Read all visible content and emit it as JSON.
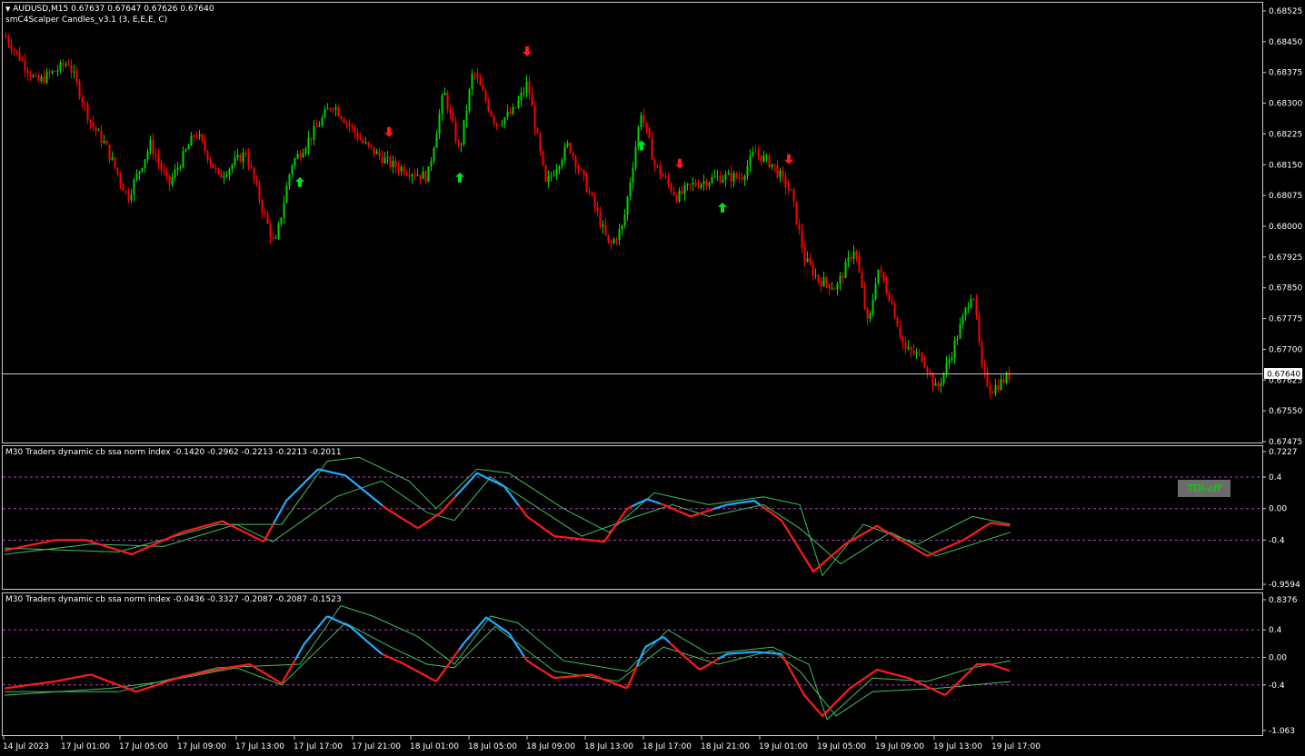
{
  "header": {
    "symbol_line": "AUDUSD,M15  0.67637 0.67647 0.67626 0.67640",
    "indicator_line": "smC4Scalper Candles_v3.1 (3, E,E,E, C)"
  },
  "colors": {
    "background": "#000000",
    "bull": "#00d400",
    "bear": "#ff0000",
    "grid": "#c8c8c8",
    "fast_up": "#22aaff",
    "fast_down": "#ff1a1a",
    "signal": "#40c060",
    "level": "#b040c0"
  },
  "price_axis": {
    "ticks": [
      "0.68525",
      "0.68450",
      "0.68375",
      "0.68300",
      "0.68225",
      "0.68150",
      "0.68075",
      "0.68000",
      "0.67925",
      "0.67850",
      "0.67775",
      "0.67700",
      "0.67625",
      "0.67550",
      "0.67475"
    ],
    "current_label": "0.67640",
    "current_value": 0.6764
  },
  "time_axis": {
    "labels": [
      "14 Jul 2023",
      "17 Jul 01:00",
      "17 Jul 05:00",
      "17 Jul 09:00",
      "17 Jul 13:00",
      "17 Jul 17:00",
      "17 Jul 21:00",
      "18 Jul 01:00",
      "18 Jul 05:00",
      "18 Jul 09:00",
      "18 Jul 13:00",
      "18 Jul 17:00",
      "18 Jul 21:00",
      "19 Jul 01:00",
      "19 Jul 05:00",
      "19 Jul 09:00",
      "19 Jul 13:00",
      "19 Jul 17:00"
    ]
  },
  "sub1": {
    "title": "M30  Traders dynamic cb ssa norm index -0.1420 -0.2962 -0.2213 -0.2213 -0.2011",
    "axis": [
      "0.7227",
      "0.4",
      "0.00",
      "-0.4",
      "-0.9594"
    ],
    "button": "TDI-off"
  },
  "sub2": {
    "title": "M30  Traders dynamic cb ssa norm index -0.0436 -0.3327 -0.2087 -0.2087 -0.1523",
    "axis": [
      "0.8376",
      "0.4",
      "0.00",
      "-0.4",
      "-1.063"
    ]
  },
  "chart_data": {
    "type": "candlestick",
    "symbol": "AUDUSD",
    "timeframe": "M15",
    "ylim": [
      0.6745,
      0.6856
    ],
    "anchors": [
      [
        0,
        0.6848
      ],
      [
        40,
        0.6835
      ],
      [
        75,
        0.684
      ],
      [
        100,
        0.6825
      ],
      [
        115,
        0.682
      ],
      [
        140,
        0.6807
      ],
      [
        165,
        0.682
      ],
      [
        185,
        0.681
      ],
      [
        215,
        0.6823
      ],
      [
        240,
        0.6812
      ],
      [
        270,
        0.6818
      ],
      [
        290,
        0.6803
      ],
      [
        302,
        0.6795
      ],
      [
        320,
        0.6815
      ],
      [
        345,
        0.6823
      ],
      [
        365,
        0.683
      ],
      [
        400,
        0.682
      ],
      [
        430,
        0.6815
      ],
      [
        470,
        0.6812
      ],
      [
        488,
        0.6833
      ],
      [
        505,
        0.6818
      ],
      [
        520,
        0.6838
      ],
      [
        545,
        0.6825
      ],
      [
        565,
        0.6828
      ],
      [
        580,
        0.6835
      ],
      [
        600,
        0.681
      ],
      [
        625,
        0.682
      ],
      [
        650,
        0.6807
      ],
      [
        670,
        0.6795
      ],
      [
        685,
        0.68
      ],
      [
        705,
        0.6828
      ],
      [
        720,
        0.6815
      ],
      [
        745,
        0.6807
      ],
      [
        760,
        0.681
      ],
      [
        790,
        0.6812
      ],
      [
        815,
        0.6812
      ],
      [
        830,
        0.6818
      ],
      [
        850,
        0.6815
      ],
      [
        870,
        0.6808
      ],
      [
        885,
        0.6792
      ],
      [
        900,
        0.6787
      ],
      [
        920,
        0.6785
      ],
      [
        940,
        0.6795
      ],
      [
        955,
        0.6775
      ],
      [
        965,
        0.679
      ],
      [
        980,
        0.6782
      ],
      [
        995,
        0.677
      ],
      [
        1015,
        0.6768
      ],
      [
        1030,
        0.676
      ],
      [
        1045,
        0.6768
      ],
      [
        1060,
        0.6778
      ],
      [
        1070,
        0.6785
      ],
      [
        1080,
        0.6765
      ],
      [
        1090,
        0.676
      ],
      [
        1112,
        0.6764
      ]
    ],
    "up_arrows": [
      330,
      506,
      706,
      795
    ],
    "down_arrows": [
      428,
      580,
      748,
      868
    ],
    "osc1": {
      "fast": [
        [
          5,
          -0.53
        ],
        [
          60,
          -0.4
        ],
        [
          95,
          -0.4
        ],
        [
          145,
          -0.58
        ],
        [
          200,
          -0.3
        ],
        [
          245,
          -0.16
        ],
        [
          290,
          -0.42
        ],
        [
          315,
          0.1
        ],
        [
          350,
          0.5
        ],
        [
          380,
          0.42
        ],
        [
          425,
          0.0
        ],
        [
          460,
          -0.25
        ],
        [
          485,
          -0.05
        ],
        [
          525,
          0.45
        ],
        [
          555,
          0.28
        ],
        [
          580,
          -0.1
        ],
        [
          610,
          -0.35
        ],
        [
          665,
          -0.42
        ],
        [
          690,
          0.0
        ],
        [
          712,
          0.12
        ],
        [
          730,
          0.05
        ],
        [
          760,
          -0.1
        ],
        [
          800,
          0.05
        ],
        [
          830,
          0.1
        ],
        [
          860,
          -0.15
        ],
        [
          895,
          -0.8
        ],
        [
          930,
          -0.45
        ],
        [
          965,
          -0.22
        ],
        [
          1020,
          -0.6
        ],
        [
          1060,
          -0.4
        ],
        [
          1090,
          -0.18
        ],
        [
          1112,
          -0.22
        ]
      ],
      "slow": [
        [
          5,
          -0.58
        ],
        [
          100,
          -0.45
        ],
        [
          180,
          -0.48
        ],
        [
          260,
          -0.2
        ],
        [
          300,
          -0.42
        ],
        [
          370,
          0.15
        ],
        [
          420,
          0.35
        ],
        [
          470,
          -0.05
        ],
        [
          500,
          -0.15
        ],
        [
          540,
          0.4
        ],
        [
          600,
          -0.05
        ],
        [
          640,
          -0.35
        ],
        [
          700,
          -0.1
        ],
        [
          740,
          0.05
        ],
        [
          780,
          -0.1
        ],
        [
          840,
          0.05
        ],
        [
          880,
          -0.25
        ],
        [
          925,
          -0.7
        ],
        [
          980,
          -0.3
        ],
        [
          1030,
          -0.6
        ],
        [
          1112,
          -0.3
        ]
      ],
      "slow2": [
        [
          5,
          -0.5
        ],
        [
          130,
          -0.55
        ],
        [
          240,
          -0.2
        ],
        [
          310,
          -0.2
        ],
        [
          360,
          0.6
        ],
        [
          395,
          0.65
        ],
        [
          450,
          0.35
        ],
        [
          480,
          0.0
        ],
        [
          525,
          0.5
        ],
        [
          560,
          0.45
        ],
        [
          620,
          0.0
        ],
        [
          670,
          -0.3
        ],
        [
          720,
          0.2
        ],
        [
          780,
          0.05
        ],
        [
          840,
          0.15
        ],
        [
          880,
          0.05
        ],
        [
          905,
          -0.85
        ],
        [
          950,
          -0.2
        ],
        [
          1010,
          -0.45
        ],
        [
          1070,
          -0.1
        ],
        [
          1112,
          -0.2
        ]
      ],
      "up_segments": [
        [
          300,
          420
        ],
        [
          500,
          570
        ],
        [
          695,
          725
        ],
        [
          785,
          835
        ]
      ]
    },
    "osc2": {
      "fast": [
        [
          5,
          -0.45
        ],
        [
          60,
          -0.35
        ],
        [
          100,
          -0.25
        ],
        [
          150,
          -0.5
        ],
        [
          200,
          -0.28
        ],
        [
          250,
          -0.15
        ],
        [
          275,
          -0.1
        ],
        [
          310,
          -0.38
        ],
        [
          335,
          0.2
        ],
        [
          360,
          0.6
        ],
        [
          385,
          0.45
        ],
        [
          420,
          0.05
        ],
        [
          445,
          -0.1
        ],
        [
          480,
          -0.35
        ],
        [
          510,
          0.2
        ],
        [
          535,
          0.58
        ],
        [
          560,
          0.35
        ],
        [
          580,
          -0.05
        ],
        [
          610,
          -0.3
        ],
        [
          650,
          -0.25
        ],
        [
          690,
          -0.45
        ],
        [
          710,
          0.15
        ],
        [
          730,
          0.3
        ],
        [
          750,
          0.05
        ],
        [
          770,
          -0.18
        ],
        [
          800,
          0.05
        ],
        [
          830,
          0.08
        ],
        [
          860,
          0.05
        ],
        [
          885,
          -0.55
        ],
        [
          905,
          -0.85
        ],
        [
          935,
          -0.45
        ],
        [
          965,
          -0.18
        ],
        [
          1000,
          -0.3
        ],
        [
          1040,
          -0.55
        ],
        [
          1075,
          -0.1
        ],
        [
          1090,
          -0.1
        ],
        [
          1112,
          -0.2
        ]
      ],
      "slow": [
        [
          5,
          -0.55
        ],
        [
          120,
          -0.45
        ],
        [
          180,
          -0.35
        ],
        [
          260,
          -0.15
        ],
        [
          310,
          -0.4
        ],
        [
          380,
          0.5
        ],
        [
          430,
          0.15
        ],
        [
          470,
          -0.1
        ],
        [
          500,
          -0.15
        ],
        [
          545,
          0.45
        ],
        [
          610,
          -0.2
        ],
        [
          680,
          -0.35
        ],
        [
          730,
          0.15
        ],
        [
          790,
          -0.1
        ],
        [
          850,
          0.1
        ],
        [
          880,
          -0.2
        ],
        [
          920,
          -0.85
        ],
        [
          960,
          -0.5
        ],
        [
          1030,
          -0.45
        ],
        [
          1112,
          -0.35
        ]
      ],
      "slow2": [
        [
          5,
          -0.5
        ],
        [
          130,
          -0.5
        ],
        [
          240,
          -0.15
        ],
        [
          330,
          -0.1
        ],
        [
          375,
          0.75
        ],
        [
          410,
          0.6
        ],
        [
          460,
          0.3
        ],
        [
          500,
          -0.1
        ],
        [
          540,
          0.6
        ],
        [
          570,
          0.5
        ],
        [
          620,
          -0.05
        ],
        [
          690,
          -0.2
        ],
        [
          735,
          0.4
        ],
        [
          780,
          0.05
        ],
        [
          850,
          0.15
        ],
        [
          890,
          -0.1
        ],
        [
          910,
          -0.9
        ],
        [
          960,
          -0.3
        ],
        [
          1020,
          -0.35
        ],
        [
          1070,
          -0.15
        ],
        [
          1112,
          -0.05
        ]
      ],
      "up_segments": [
        [
          325,
          420
        ],
        [
          505,
          575
        ],
        [
          700,
          735
        ],
        [
          790,
          860
        ]
      ]
    }
  }
}
